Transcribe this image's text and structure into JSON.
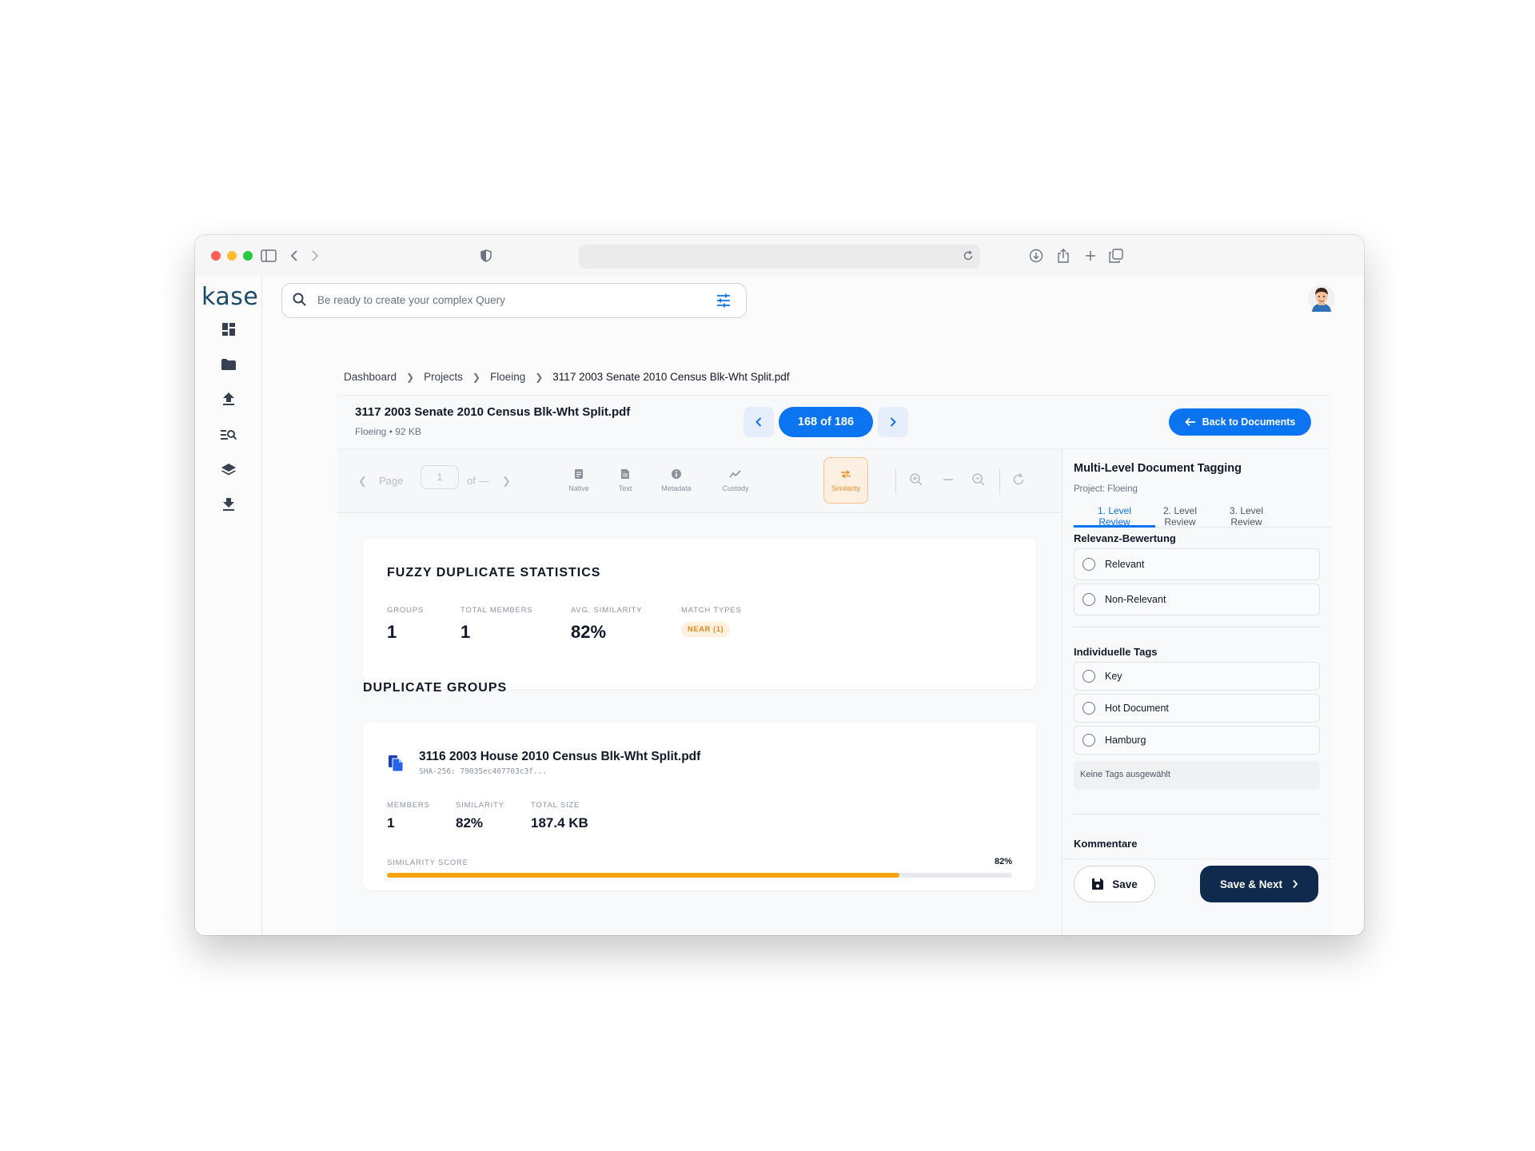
{
  "app": {
    "logo": "kase",
    "search_placeholder": "Be ready to create your complex Query"
  },
  "sidebar": {
    "items": [
      {
        "name": "dashboard",
        "icon": "dashboard-icon"
      },
      {
        "name": "projects",
        "icon": "folder-icon"
      },
      {
        "name": "upload",
        "icon": "upload-icon"
      },
      {
        "name": "search",
        "icon": "search-list-icon"
      },
      {
        "name": "layers",
        "icon": "layers-icon"
      },
      {
        "name": "download",
        "icon": "download-icon"
      }
    ]
  },
  "breadcrumb": [
    "Dashboard",
    "Projects",
    "Floeing",
    "3117 2003 Senate 2010 Census Blk-Wht Split.pdf"
  ],
  "document": {
    "title": "3117 2003 Senate 2010 Census Blk-Wht Split.pdf",
    "meta": "Floeing • 92 KB",
    "counter": "168 of 186",
    "back_label": "Back to Documents"
  },
  "viewer_toolbar": {
    "page_label": "Page",
    "page_value": "1",
    "of_label": "of —",
    "tools": [
      {
        "label": "Native",
        "icon": "document-icon",
        "active": false
      },
      {
        "label": "Text",
        "icon": "text-icon",
        "active": false
      },
      {
        "label": "Metadata",
        "icon": "info-icon",
        "active": false
      },
      {
        "label": "Custody",
        "icon": "trend-icon",
        "active": false
      },
      {
        "label": "Similarity",
        "icon": "compare-icon",
        "active": true
      }
    ]
  },
  "fuzzy_stats": {
    "title": "FUZZY DUPLICATE STATISTICS",
    "groups_label": "GROUPS",
    "groups_value": "1",
    "members_label": "TOTAL MEMBERS",
    "members_value": "1",
    "avg_label": "AVG. SIMILARITY",
    "avg_value": "82%",
    "match_label": "MATCH TYPES",
    "match_badge": "NEAR (1)"
  },
  "duplicate_groups": {
    "title": "DUPLICATE GROUPS",
    "groups": [
      {
        "name": "3116 2003 House 2010 Census Blk-Wht Split.pdf",
        "hash": "SHA-256: 79035ec407703c3f...",
        "members_label": "MEMBERS",
        "members_value": "1",
        "similarity_label": "SIMILARITY",
        "similarity_value": "82%",
        "size_label": "TOTAL SIZE",
        "size_value": "187.4 KB",
        "score_label": "SIMILARITY SCORE",
        "score_text": "82%",
        "score_fraction": 0.82
      }
    ]
  },
  "tagging": {
    "title": "Multi-Level Document Tagging",
    "project": "Project: Floeing",
    "tabs": [
      {
        "line1": "1. Level",
        "line2": "Review"
      },
      {
        "line1": "2. Level",
        "line2": "Review"
      },
      {
        "line1": "3. Level",
        "line2": "Review"
      }
    ],
    "relevance_title": "Relevanz-Bewertung",
    "relevance_options": [
      "Relevant",
      "Non-Relevant"
    ],
    "tags_title": "Individuelle Tags",
    "tag_options": [
      "Key",
      "Hot Document",
      "Hamburg"
    ],
    "no_tags": "Keine Tags ausgewählt",
    "comments_title": "Kommentare",
    "save_label": "Save",
    "save_next_label": "Save & Next"
  },
  "colors": {
    "primary": "#0b74f0",
    "navy": "#0f2a4d",
    "accent_orange": "#f5a30f"
  }
}
